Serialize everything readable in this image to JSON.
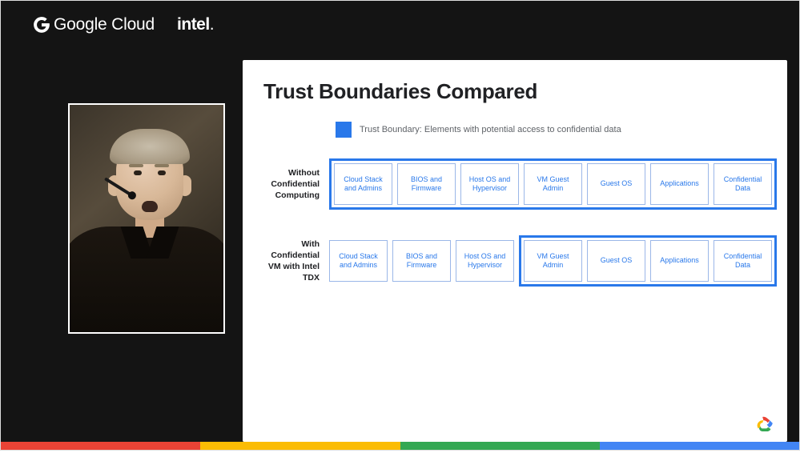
{
  "header": {
    "google_cloud": "Google Cloud",
    "intel": "intel"
  },
  "slide": {
    "title": "Trust Boundaries Compared",
    "legend": "Trust Boundary: Elements with potential access to confidential data",
    "rows": [
      {
        "label": "Without Confidential Computing",
        "boxes": [
          "Cloud Stack and Admins",
          "BIOS and Firmware",
          "Host OS and Hypervisor",
          "VM Guest Admin",
          "Guest OS",
          "Applications",
          "Confidential Data"
        ],
        "trusted_all": true
      },
      {
        "label": "With Confidential VM with Intel TDX",
        "outside": [
          "Cloud Stack and Admins",
          "BIOS and Firmware",
          "Host OS and Hypervisor"
        ],
        "trusted": [
          "VM Guest Admin",
          "Guest OS",
          "Applications",
          "Confidential Data"
        ]
      }
    ]
  },
  "colors": {
    "accent": "#2978ea",
    "google_red": "#ea4335",
    "google_yellow": "#fbbc04",
    "google_green": "#34a853",
    "google_blue": "#4285f4"
  }
}
